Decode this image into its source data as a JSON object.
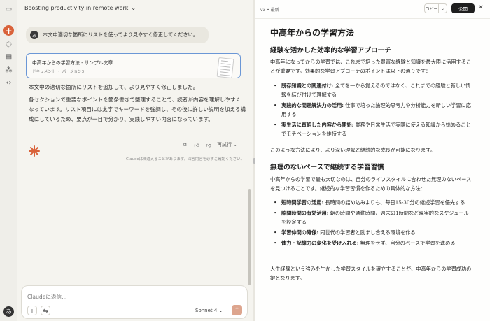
{
  "chat": {
    "title": "Boosting productivity in remote work",
    "user_avatar": "あ",
    "user_message": "本文中適切な箇所にリストを使ってより見やすく修正してください。",
    "artifact_title": "中高年からの学習方法 - サンプル文章",
    "artifact_meta": "ドキュメント ・ バージョン3",
    "reply_1": "本文中の適切な箇所にリストを追加して、より見やすく修正しました。",
    "reply_2": "各セクションで重要なポイントを箇条書きで整理することで、読者が内容を理解しやすくなっています。リスト項目には太字でキーワードを強調し、その後に詳しい説明を加える構成にしているため、要点が一目で分かり、実践しやすい内容になっています。",
    "retry_label": "再試行",
    "disclaimer": "Claudeは間違えることがあります。回答内容を必ずご確認ください。",
    "input_placeholder": "Claudeに返信...",
    "model_label": "Sonnet 4"
  },
  "panel": {
    "version": "v3 • 最新",
    "copy_label": "コピー",
    "publish_label": "公開"
  },
  "doc": {
    "title": "中高年からの学習方法",
    "h2_1": "経験を活かした効率的な学習アプローチ",
    "p1": "中高年になってからの学習では、これまで培った豊富な経験と知識を最大限に活用することが重要です。効果的な学習アプローチのポイントは以下の通りです：",
    "list1": [
      {
        "b": "既存知識との関連付け:",
        "t": " 全てを一から覚えるのではなく、これまでの経験と新しい情報を結び付けて理解する"
      },
      {
        "b": "実践的な問題解決力の活用:",
        "t": " 仕事で培った論理的思考力や分析能力を新しい学習に応用する"
      },
      {
        "b": "実生活に直結した内容から開始:",
        "t": " 業務や日常生活で実際に使える知識から始めることでモチベーションを維持する"
      }
    ],
    "p2": "このような方法により、より深い理解と継続的な成長が可能になります。",
    "h2_2": "無理のないペースで継続する学習習慣",
    "p3": "中高年からの学習で最も大切なのは、自分のライフスタイルに合わせた無理のないペースを見つけることです。継続的な学習習慣を作るための具体的な方法：",
    "list2": [
      {
        "b": "短時間学習の活用:",
        "t": " 長時間の詰め込みよりも、毎日15-30分の継続学習を優先する"
      },
      {
        "b": "隙間時間の有効活用:",
        "t": " 朝の時間や通勤時間、週末の1時間など現実的なスケジュールを設定する"
      },
      {
        "b": "学習仲間の確保:",
        "t": " 同世代の学習者と励まし合える環境を作る"
      },
      {
        "b": "体力・記憶力の変化を受け入れる:",
        "t": " 無理をせず、自分のペースで学習を進める"
      }
    ],
    "p4": "人生経験という強みを生かした学習スタイルを確立することが、中高年からの学習成功の鍵となります。"
  },
  "icons": [
    "sidebar-toggle-icon",
    "new-chat-icon",
    "chats-icon",
    "projects-icon",
    "artifacts-icon",
    "code-icon",
    "sparkle-icon",
    "copy-icon",
    "thumbs-up-icon",
    "thumbs-down-icon",
    "plus-icon",
    "settings-icon",
    "send-icon",
    "close-icon"
  ],
  "colors": {
    "accent": "#d9623a",
    "selection_border": "#6b97d6",
    "publish_bg": "#1f1f1f"
  }
}
